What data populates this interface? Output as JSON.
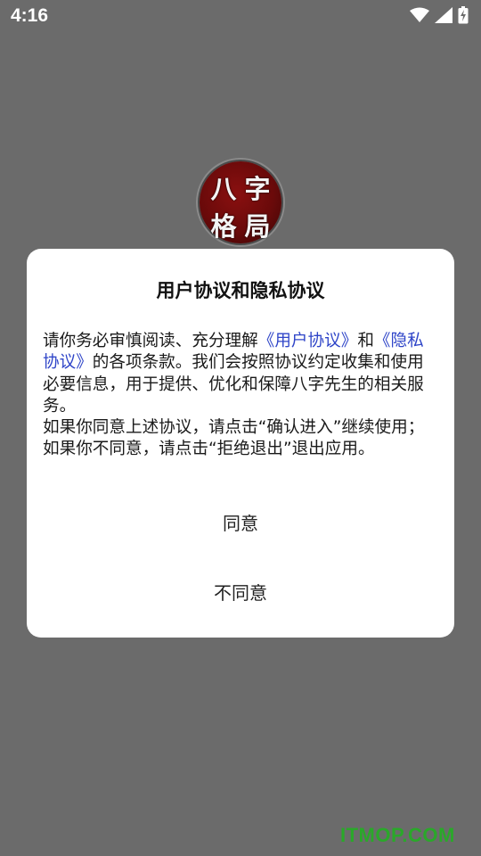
{
  "status_bar": {
    "time": "4:16",
    "icons": [
      "wifi-icon",
      "signal-icon",
      "battery-icon"
    ]
  },
  "app": {
    "logo_chars": [
      "八",
      "字",
      "格",
      "局"
    ],
    "logo_color": "#7a0c0c"
  },
  "dialog": {
    "title": "用户协议和隐私协议",
    "body": {
      "p1_before": "请你务必审慎阅读、充分理解",
      "user_agreement_link": "《用户协议》",
      "p1_and": "和",
      "privacy_link": "《隐私协议》",
      "p1_after": "的各项条款。我们会按照协议约定收集和使用必要信息，用于提供、优化和保障八字先生的相关服务。",
      "p2": "如果你同意上述协议，请点击“确认进入”继续使用；如果你不同意，请点击“拒绝退出”退出应用。"
    },
    "agree_label": "同意",
    "disagree_label": "不同意",
    "link_color": "#2f45c8"
  },
  "watermark": "ITMOP.COM"
}
